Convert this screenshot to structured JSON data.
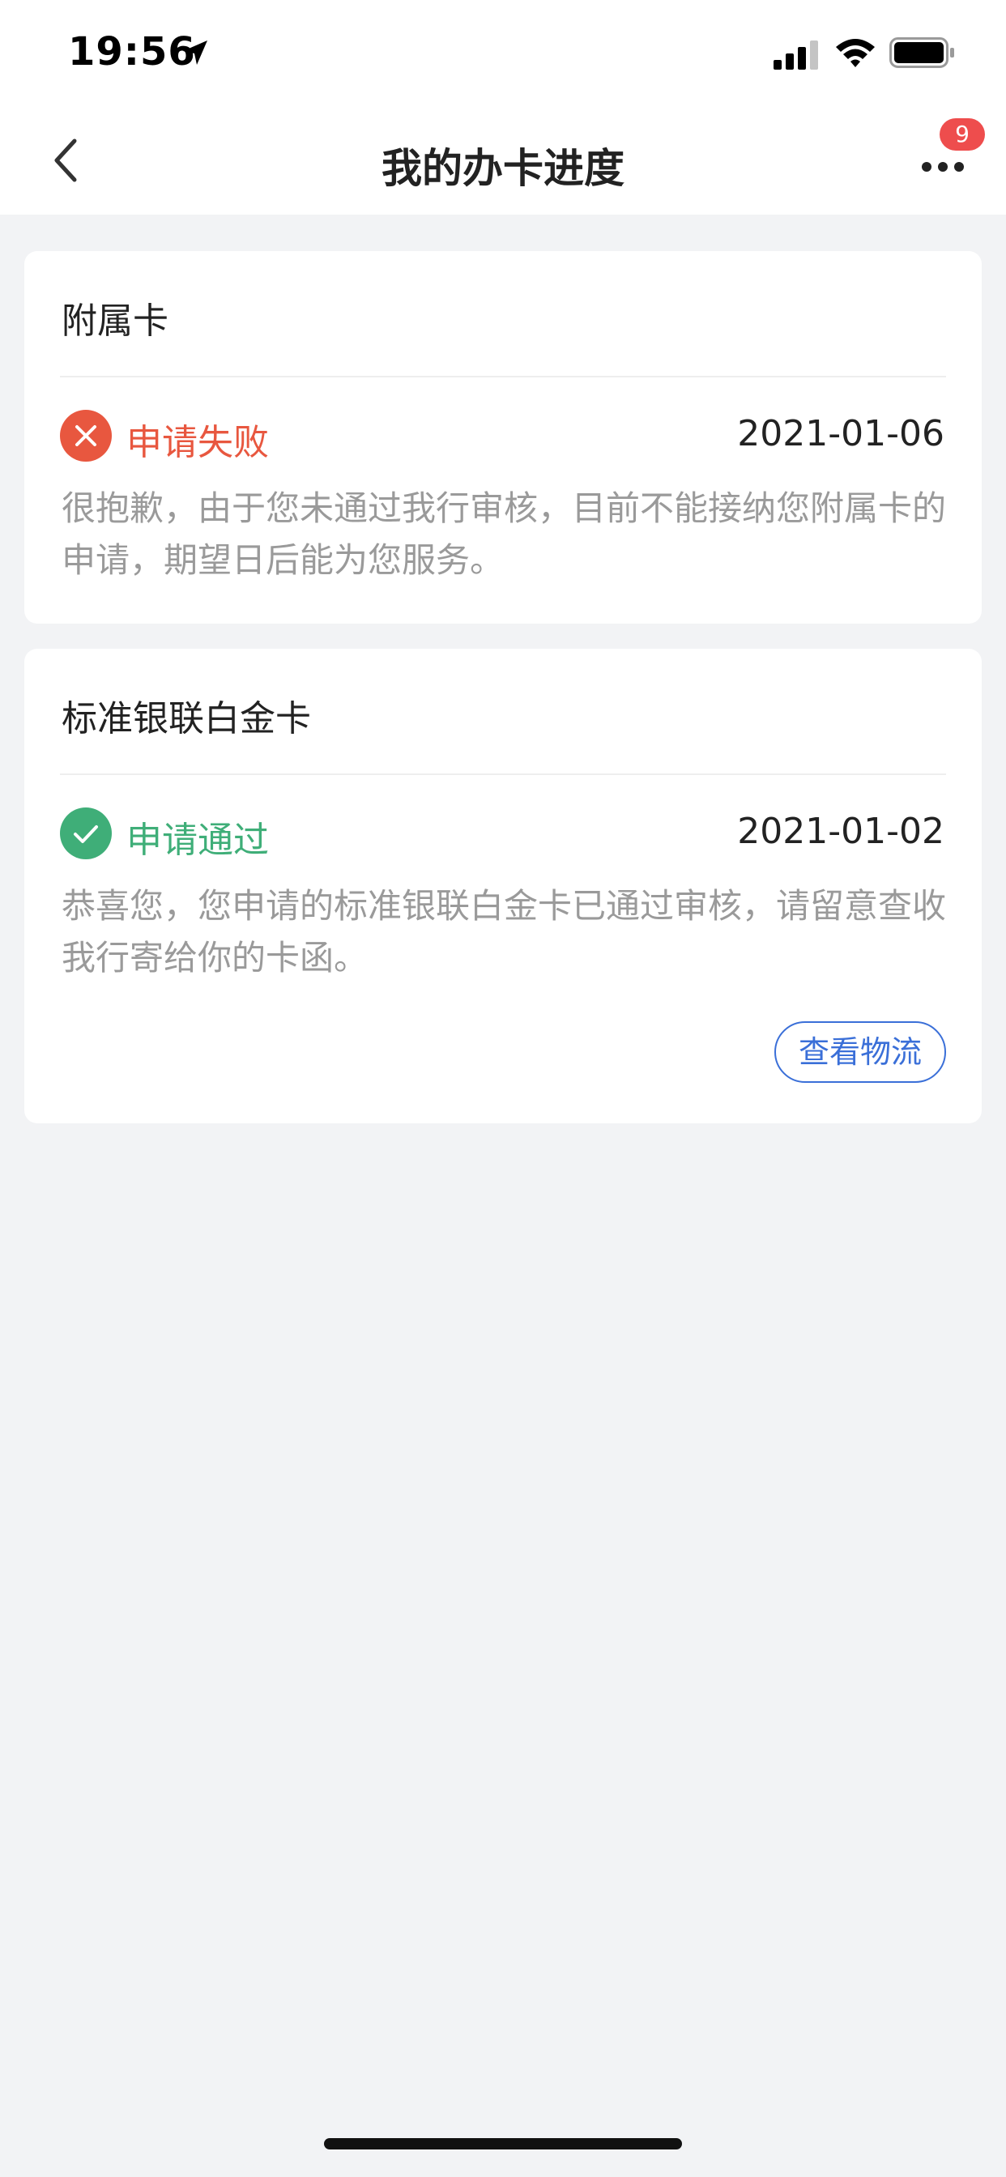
{
  "status_bar": {
    "time": "19:56",
    "icons": [
      "location-arrow-icon",
      "signal-icon",
      "wifi-icon",
      "battery-icon"
    ]
  },
  "nav": {
    "title": "我的办卡进度",
    "back_icon": "chevron-left-icon",
    "more_icon": "more-dots-icon",
    "badge": "9"
  },
  "cards": [
    {
      "title": "附属卡",
      "status": "申请失败",
      "status_icon": "close-circle-icon",
      "date": "2021-01-06",
      "description": "很抱歉，由于您未通过我行审核，目前不能接纳您附属卡的申请，期望日后能为您服务。"
    },
    {
      "title": "标准银联白金卡",
      "status": "申请通过",
      "status_icon": "check-circle-icon",
      "date": "2021-01-02",
      "description": "恭喜您，您申请的标准银联白金卡已通过审核，请留意查收我行寄给你的卡函。",
      "action_label": "查看物流"
    }
  ],
  "colors": {
    "fail": "#e8573f",
    "pass": "#3fae78",
    "link": "#3a6fd8",
    "badge": "#ee4d4d",
    "background": "#f2f3f5"
  }
}
